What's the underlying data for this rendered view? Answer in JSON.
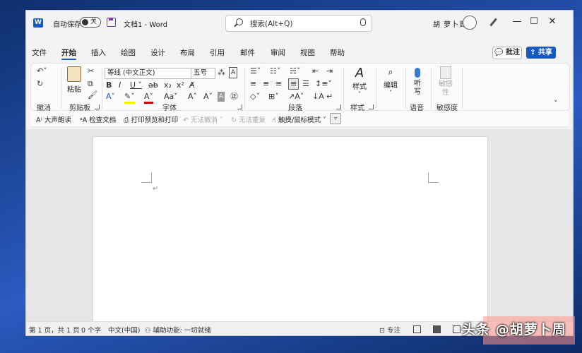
{
  "title_bar": {
    "app_icon": "word-icon",
    "autosave_label": "自动保存",
    "autosave_state": "关",
    "doc_title": "文档1 - Word",
    "search_placeholder": "搜索(Alt+Q)",
    "user_name": "胡 萝卜周",
    "minimize": "—",
    "maximize": "☐",
    "close": "✕"
  },
  "tabs": [
    "文件",
    "开始",
    "插入",
    "绘图",
    "设计",
    "布局",
    "引用",
    "邮件",
    "审阅",
    "视图",
    "帮助"
  ],
  "active_tab": "开始",
  "comment_label": "批注",
  "share_label": "共享",
  "ribbon": {
    "undo_group": "撤消",
    "clipboard": {
      "paste": "粘贴",
      "group": "剪贴板"
    },
    "font": {
      "name": "等线 (中文正文)",
      "size": "五号",
      "group": "字体"
    },
    "paragraph": {
      "group": "段落"
    },
    "styles": {
      "label": "样式",
      "group": "样式"
    },
    "editing": {
      "label": "编辑"
    },
    "voice": {
      "label": "听写",
      "group": "语音"
    },
    "sensitivity": {
      "label": "敏感性",
      "group": "敏感度"
    }
  },
  "quick_access": [
    {
      "label": "大声朗读",
      "dim": false
    },
    {
      "label": "检查文档",
      "dim": false
    },
    {
      "label": "打印预览和打印",
      "dim": false
    },
    {
      "label": "无法撤消",
      "dim": true
    },
    {
      "label": "无法重复",
      "dim": true
    },
    {
      "label": "触摸/鼠标模式",
      "dim": false
    }
  ],
  "status_bar": {
    "page": "第 1 页，共 1 页",
    "words": "0 个字",
    "language": "中文(中国)",
    "accessibility": "辅助功能: 一切就绪",
    "focus": "专注"
  },
  "watermark": "头条 @胡萝卜周"
}
